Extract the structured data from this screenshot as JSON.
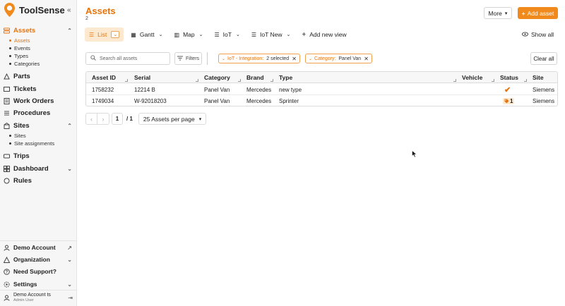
{
  "brand": {
    "name": "ToolSense",
    "accent": "#f08a1c"
  },
  "sidebar": {
    "collapse_icon": "double-chevron-left-icon",
    "nav": [
      {
        "label": "Assets",
        "icon": "assets-icon",
        "active": true
      },
      {
        "label": "Parts",
        "icon": "parts-icon"
      },
      {
        "label": "Tickets",
        "icon": "tickets-icon"
      },
      {
        "label": "Work Orders",
        "icon": "work-orders-icon"
      },
      {
        "label": "Procedures",
        "icon": "procedures-icon"
      },
      {
        "label": "Sites",
        "icon": "sites-icon"
      },
      {
        "label": "Trips",
        "icon": "trips-icon"
      },
      {
        "label": "Dashboard",
        "icon": "dashboard-icon"
      },
      {
        "label": "Rules",
        "icon": "rules-icon"
      }
    ],
    "assets_sub": [
      "Assets",
      "Events",
      "Types",
      "Categories"
    ],
    "sites_sub": [
      "Sites",
      "Site assignments"
    ],
    "bottom": [
      {
        "label": "Demo Account",
        "icon": "user-icon"
      },
      {
        "label": "Organization",
        "icon": "organization-icon"
      },
      {
        "label": "Need Support?",
        "icon": "help-icon"
      },
      {
        "label": "Settings",
        "icon": "gear-icon"
      }
    ],
    "user": {
      "name": "Demo Account ts",
      "role": "Admin User"
    }
  },
  "header": {
    "title": "Assets",
    "count": "2",
    "more_label": "More",
    "add_label": "Add asset"
  },
  "views": {
    "tabs": [
      "List",
      "Gantt",
      "Map",
      "IoT",
      "IoT New"
    ],
    "add_view": "Add new view",
    "show_all": "Show all"
  },
  "filters": {
    "search_placeholder": "Search all assets",
    "filters_label": "Filters",
    "chip1_key": "IoT - Integration:",
    "chip1_value": "2 selected",
    "chip2_key": "Category:",
    "chip2_value": "Panel Van",
    "clear_all": "Clear all"
  },
  "table": {
    "columns": [
      "Asset ID",
      "Serial",
      "Category",
      "Brand",
      "Type",
      "Vehicle",
      "Status",
      "Site"
    ],
    "rows": [
      {
        "asset_id": "1758232",
        "serial": "12214 B",
        "category": "Panel Van",
        "brand": "Mercedes",
        "type": "new type",
        "vehicle": "",
        "status": "check",
        "site": "Siemens"
      },
      {
        "asset_id": "1749034",
        "serial": "W-92018203",
        "category": "Panel Van",
        "brand": "Mercedes",
        "type": "Sprinter",
        "vehicle": "",
        "status_count": "1",
        "site": "Siemens"
      }
    ]
  },
  "pagination": {
    "page": "1",
    "total": "/ 1",
    "per_page": "25 Assets per page"
  }
}
